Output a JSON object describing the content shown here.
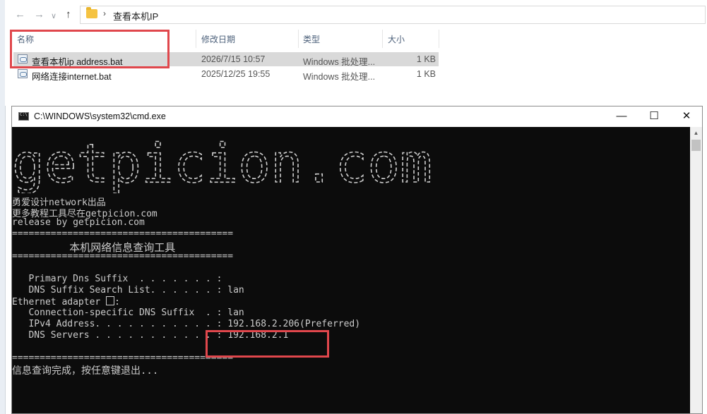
{
  "explorer": {
    "nav": {
      "back_icon": "arrow-left-icon",
      "forward_icon": "arrow-right-icon",
      "up_icon": "arrow-up-icon"
    },
    "breadcrumb": {
      "separator": "›",
      "current": "查看本机IP"
    },
    "columns": {
      "name": "名称",
      "modified": "修改日期",
      "type": "类型",
      "size": "大小"
    },
    "files": [
      {
        "name": "查看本机ip address.bat",
        "modified": "2026/7/15 10:57",
        "type": "Windows 批处理...",
        "size": "1 KB"
      },
      {
        "name": "网络连接internet.bat",
        "modified": "2025/12/25 19:55",
        "type": "Windows 批处理...",
        "size": "1 KB"
      }
    ]
  },
  "cmd": {
    "title": "C:\\WINDOWS\\system32\\cmd.exe",
    "controls": {
      "minimize": "—",
      "maximize": "☐",
      "close": "✕"
    },
    "art_text": "getpicion.com",
    "lines": {
      "credit": "勇爱设计network出品",
      "more": "更多教程工具尽在getpicion.com",
      "release": "release by getpicion.com",
      "sep1": "========================================",
      "tool": "         本机网络信息查询工具",
      "sep2": "========================================",
      "primary_dns": "   Primary Dns Suffix  . . . . . . . :",
      "dns_search": "   DNS Suffix Search List. . . . . . : lan",
      "eth_prefix": "Ethernet adapter ",
      "eth_suffix": ":",
      "conn_dns": "   Connection-specific DNS Suffix  . : lan",
      "ipv4": "   IPv4 Address. . . . . . . . . . . : 192.168.2.206(Preferred)",
      "dns_servers": "   DNS Servers . . . . . . . . . . . : 192.168.2.1",
      "sep3": "========================================",
      "done": "信息查询完成，按任意键退出..."
    }
  },
  "colors": {
    "highlight": "#e0474c",
    "console_bg": "#0c0c0c",
    "console_text": "#cccccc"
  }
}
